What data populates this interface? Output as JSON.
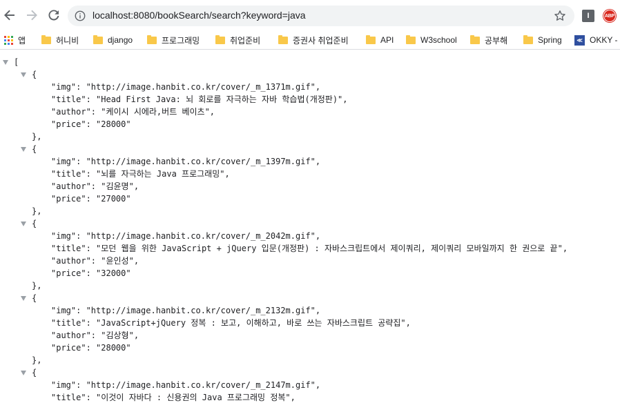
{
  "browser": {
    "url": "localhost:8080/bookSearch/search?keyword=java",
    "extensions": [
      {
        "name": "ext-i",
        "label": "I"
      },
      {
        "name": "adblock-plus",
        "label": "ABP"
      }
    ]
  },
  "bookmarks": [
    {
      "label": "앱",
      "icon": "apps-grid-icon"
    },
    {
      "label": "허니비",
      "icon": "folder-icon"
    },
    {
      "label": "django",
      "icon": "folder-icon"
    },
    {
      "label": "프로그래밍",
      "icon": "folder-icon"
    },
    {
      "label": "취업준비",
      "icon": "folder-icon"
    },
    {
      "label": "증권사 취업준비",
      "icon": "folder-icon"
    },
    {
      "label": "API",
      "icon": "folder-icon"
    },
    {
      "label": "W3school",
      "icon": "folder-icon"
    },
    {
      "label": "공부해",
      "icon": "folder-icon"
    },
    {
      "label": "Spring",
      "icon": "folder-icon"
    },
    {
      "label": "OKKY -",
      "icon": "okky-icon"
    }
  ],
  "json_lines": [
    {
      "indent": 0,
      "text": "[",
      "tri": true
    },
    {
      "indent": 1,
      "text": "{",
      "tri": true
    },
    {
      "indent": 2,
      "text": "\"img\": \"http://image.hanbit.co.kr/cover/_m_1371m.gif\","
    },
    {
      "indent": 2,
      "text": "\"title\": \"Head First Java: 뇌 회로를 자극하는 자바 학습법(개정판)\","
    },
    {
      "indent": 2,
      "text": "\"author\": \"케이시 시에라,버트 베이츠\","
    },
    {
      "indent": 2,
      "text": "\"price\": \"28000\""
    },
    {
      "indent": 1,
      "text": "},"
    },
    {
      "indent": 1,
      "text": "{",
      "tri": true
    },
    {
      "indent": 2,
      "text": "\"img\": \"http://image.hanbit.co.kr/cover/_m_1397m.gif\","
    },
    {
      "indent": 2,
      "text": "\"title\": \"뇌를 자극하는 Java 프로그래밍\","
    },
    {
      "indent": 2,
      "text": "\"author\": \"김윤명\","
    },
    {
      "indent": 2,
      "text": "\"price\": \"27000\""
    },
    {
      "indent": 1,
      "text": "},"
    },
    {
      "indent": 1,
      "text": "{",
      "tri": true
    },
    {
      "indent": 2,
      "text": "\"img\": \"http://image.hanbit.co.kr/cover/_m_2042m.gif\","
    },
    {
      "indent": 2,
      "text": "\"title\": \"모던 웹을 위한 JavaScript + jQuery 입문(개정판) : 자바스크립트에서 제이쿼리, 제이쿼리 모바일까지 한 권으로 끝\","
    },
    {
      "indent": 2,
      "text": "\"author\": \"윤인성\","
    },
    {
      "indent": 2,
      "text": "\"price\": \"32000\""
    },
    {
      "indent": 1,
      "text": "},"
    },
    {
      "indent": 1,
      "text": "{",
      "tri": true
    },
    {
      "indent": 2,
      "text": "\"img\": \"http://image.hanbit.co.kr/cover/_m_2132m.gif\","
    },
    {
      "indent": 2,
      "text": "\"title\": \"JavaScript+jQuery 정복 : 보고, 이해하고, 바로 쓰는 자바스크립트 공략집\","
    },
    {
      "indent": 2,
      "text": "\"author\": \"김상형\","
    },
    {
      "indent": 2,
      "text": "\"price\": \"28000\""
    },
    {
      "indent": 1,
      "text": "},"
    },
    {
      "indent": 1,
      "text": "{",
      "tri": true
    },
    {
      "indent": 2,
      "text": "\"img\": \"http://image.hanbit.co.kr/cover/_m_2147m.gif\","
    },
    {
      "indent": 2,
      "text": "\"title\": \"이것이 자바다 : 신용권의 Java 프로그래밍 정복\","
    }
  ]
}
